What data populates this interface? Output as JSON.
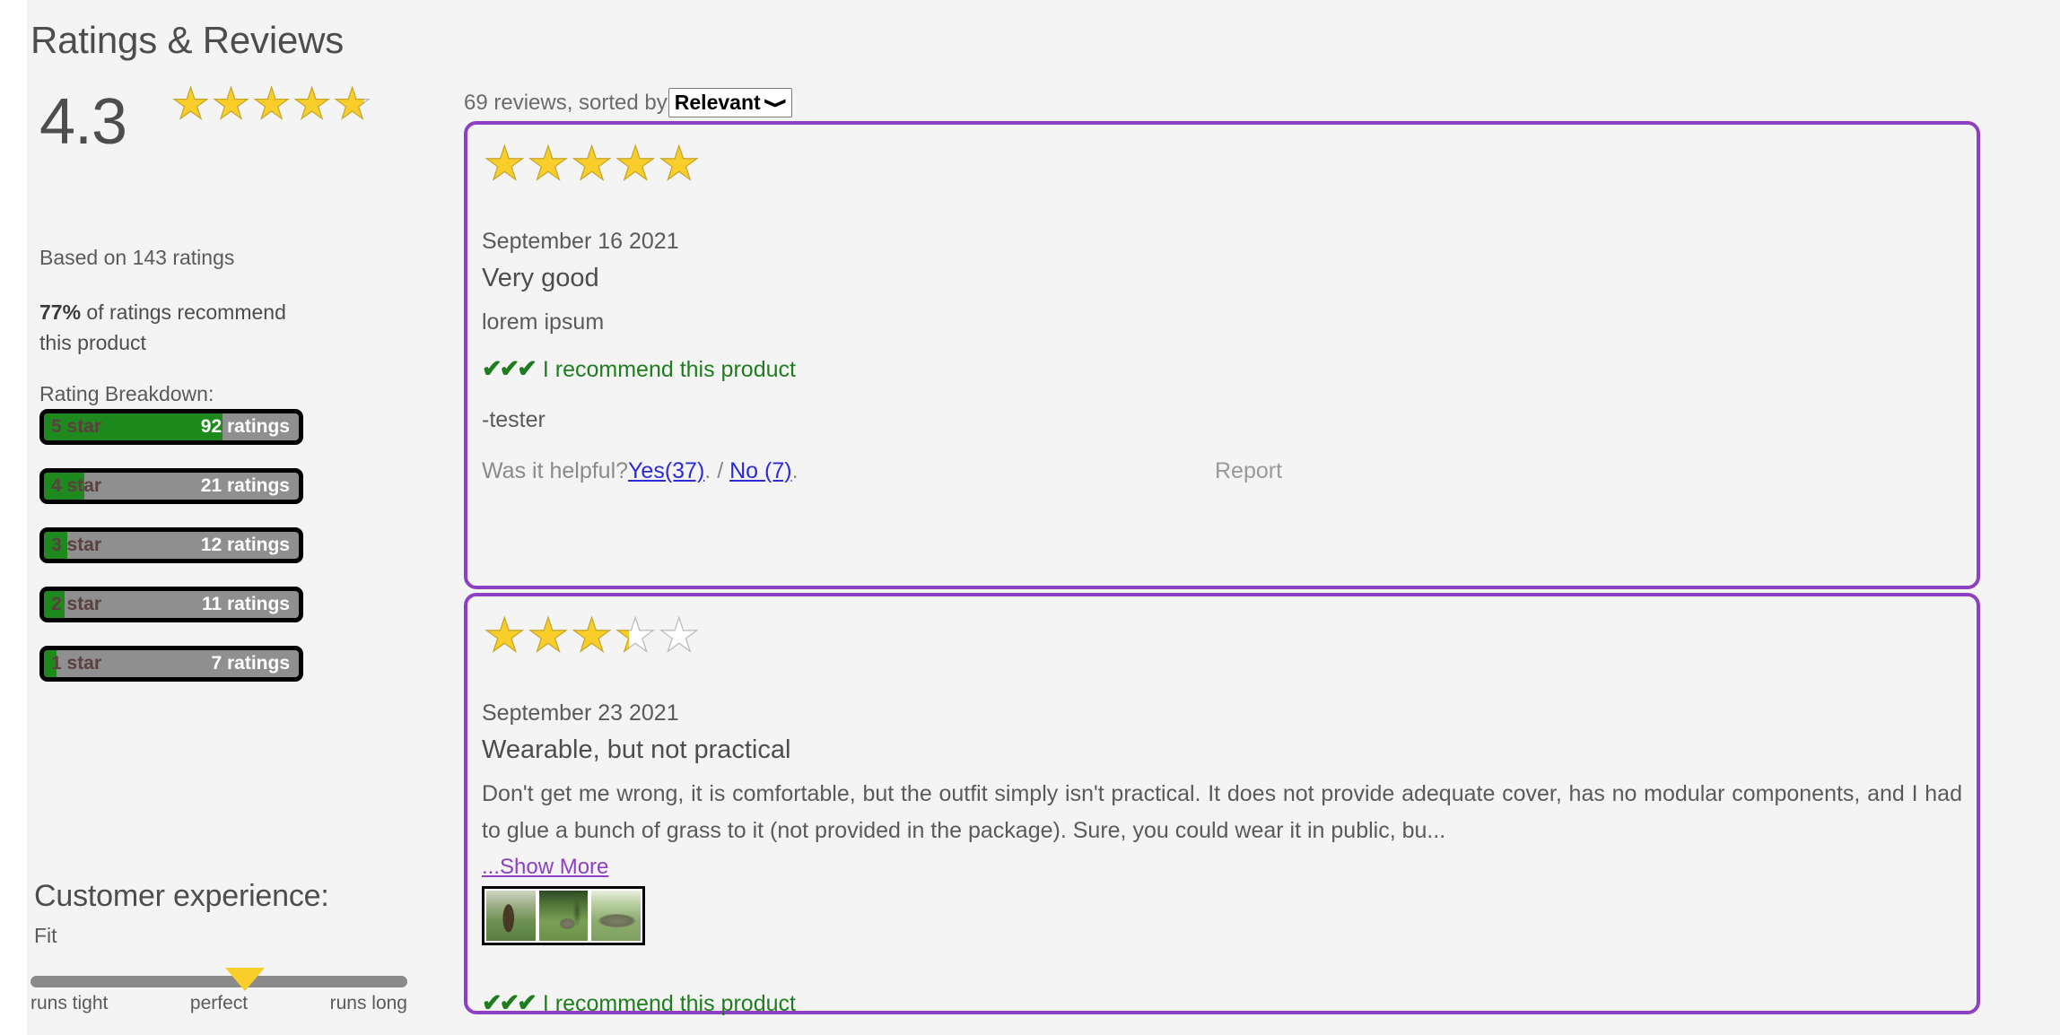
{
  "page": {
    "title": "Ratings & Reviews",
    "accent_purple": "#8e3fc4",
    "star_color": "#f9ce2b",
    "bar_fill_color": "#1e8a1e",
    "bar_track_color": "#8f8f8f"
  },
  "summary": {
    "score": "4.3",
    "score_stars": 4.3,
    "based_on": "Based on 143 ratings",
    "recommend_percent": "77%",
    "recommend_rest": " of ratings recommend this product",
    "breakdown_label": "Rating Breakdown:",
    "breakdown": [
      {
        "label": "5 star",
        "count": "92 ratings",
        "value": 92,
        "fill_percent": 70
      },
      {
        "label": "4 star",
        "count": "21 ratings",
        "value": 21,
        "fill_percent": 16
      },
      {
        "label": "3 star",
        "count": "12 ratings",
        "value": 12,
        "fill_percent": 9
      },
      {
        "label": "2 star",
        "count": "11 ratings",
        "value": 11,
        "fill_percent": 8
      },
      {
        "label": "1 star",
        "count": "7 ratings",
        "value": 7,
        "fill_percent": 5
      }
    ]
  },
  "customer_experience": {
    "title": "Customer experience:",
    "attribute": "Fit",
    "marker_percent": 57,
    "scale_left": "runs tight",
    "scale_mid": "perfect",
    "scale_right": "runs long"
  },
  "reviews_header": {
    "count_text": "69 reviews, sorted by",
    "sort_selected": "Relevant",
    "sort_options": [
      "Relevant"
    ]
  },
  "reviews": [
    {
      "stars": 5,
      "date": "September 16 2021",
      "title": "Very good",
      "body": "lorem ipsum",
      "checks": "✔✔✔",
      "recommend_text": "I recommend this product",
      "author": "-tester",
      "helpful_prompt": "Was it helpful?",
      "yes_label": "Yes(37)",
      "yes_suffix": ".",
      "separator": " / ",
      "no_label": "No (7)",
      "no_suffix": ".",
      "report_label": "Report"
    },
    {
      "stars": 3,
      "date": "September 23 2021",
      "title": "Wearable, but not practical",
      "body": "Don't get me wrong, it is comfortable, but the outfit simply isn't practical. It does not provide adequate cover, has no modular components, and I had to glue a bunch of grass to it (not provided in the package). Sure, you could wear it in public, bu...",
      "show_more": "...Show More",
      "checks": "✔✔✔",
      "recommend_text": "I recommend this product",
      "thumbnails": [
        "tree-and-hedge-photo",
        "figure-on-lawn-photo",
        "grass-pile-photo"
      ]
    }
  ]
}
